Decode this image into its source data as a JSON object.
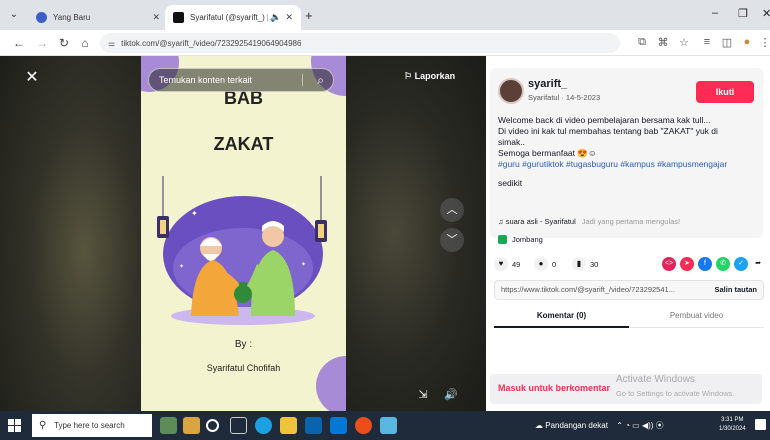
{
  "browser": {
    "tabs": [
      {
        "label": "Yang Baru",
        "active": false
      },
      {
        "label": "Syarifatul (@syarift_) | TIK",
        "active": true
      }
    ],
    "url": "tiktok.com/@syarift_/video/7232925419064904986"
  },
  "video": {
    "search_placeholder": "Temukan konten terkait",
    "report_label": "Laporkan",
    "poster": {
      "title_line1": "BAB",
      "title_line2": "ZAKAT",
      "by_label": "By :",
      "author": "Syarifatul Chofifah"
    }
  },
  "post": {
    "username": "syarift_",
    "subline": "Syarifatul · 14-5-2023",
    "follow_label": "Ikuti",
    "description_lines": [
      "Welcome back di video pembelajaran bersama kak tull...",
      "Di video ini kak tul membahas tentang bab \"ZAKAT\" yuk di",
      "simak..",
      "Semoga bermanfaat 😍☺"
    ],
    "hashtags": "#guru #gurutiktok #tugasbuguru #kampus #kampusmengajar",
    "hashtag_tail": "sedikit",
    "music": "suara asli - Syarifatul",
    "music_note": "Jadi yang pertama mengulas!",
    "location": "Jombang",
    "likes": "49",
    "comments": "0",
    "saves": "30",
    "link": "https://www.tiktok.com/@syarift_/video/723292541...",
    "copy_label": "Salin tautan",
    "tab_comments": "Komentar (0)",
    "tab_creator": "Pembuat video",
    "login_prompt": "Masuk untuk berkomentar"
  },
  "watermark": {
    "line1": "Activate Windows",
    "line2": "Go to Settings to activate Windows."
  },
  "taskbar": {
    "search_placeholder": "Type here to search",
    "weather": "Pandangan dekat",
    "time": "3:31 PM",
    "date": "1/30/2024"
  },
  "colors": {
    "accent": "#fe2c55",
    "hashtag": "#2b5db9",
    "poster_bg": "#f4f3cf",
    "poster_purple": "#a78bd6",
    "taskbar": "#1f2a3a"
  }
}
